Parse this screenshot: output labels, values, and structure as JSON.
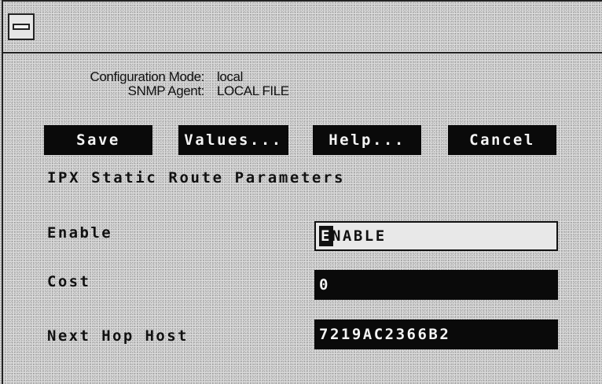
{
  "window": {
    "menu_icon": "window-menu-icon"
  },
  "info": {
    "config_mode_label": "Configuration Mode:",
    "config_mode_value": "local",
    "snmp_agent_label": "SNMP Agent:",
    "snmp_agent_value": "LOCAL FILE"
  },
  "buttons": {
    "save": "Save",
    "values": "Values...",
    "help": "Help...",
    "cancel": "Cancel"
  },
  "heading": "IPX Static Route Parameters",
  "fields": {
    "enable": {
      "label": "Enable",
      "value_cursor_char": "E",
      "value_rest": "NABLE"
    },
    "cost": {
      "label": "Cost",
      "value": "0"
    },
    "next_hop_host": {
      "label": "Next Hop Host",
      "value": "7219AC2366B2"
    }
  },
  "colors": {
    "background": "#d9d9d9",
    "button_bg": "#0a0a0a",
    "button_text": "#f4f4f4"
  }
}
